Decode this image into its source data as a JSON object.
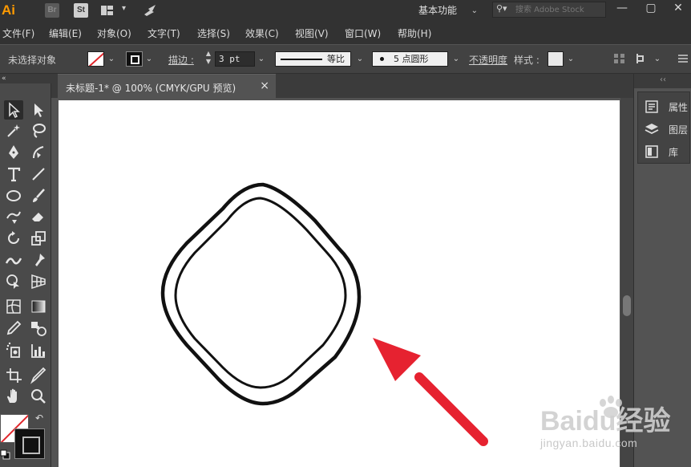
{
  "titlebar": {
    "app_logo": "Ai",
    "br_label": "Br",
    "st_label": "St",
    "workspace": "基本功能",
    "search_placeholder": "搜索 Adobe Stock",
    "minimize": "—",
    "maximize": "▢",
    "close": "✕"
  },
  "menu": {
    "items": [
      "文件(F)",
      "编辑(E)",
      "对象(O)",
      "文字(T)",
      "选择(S)",
      "效果(C)",
      "视图(V)",
      "窗口(W)",
      "帮助(H)"
    ]
  },
  "controlbar": {
    "selection_status": "未选择对象",
    "stroke_label": "描边 :",
    "stroke_weight": "3 pt",
    "stroke_profile": "等比",
    "brush_label": "5 点圆形",
    "opacity_label": "不透明度",
    "style_label": "样式 :"
  },
  "document": {
    "tab_title": "未标题-1* @ 100% (CMYK/GPU 预览)",
    "close_glyph": "×"
  },
  "right_dock": {
    "items": [
      {
        "label": "属性",
        "icon": "properties-icon"
      },
      {
        "label": "图层",
        "icon": "layers-icon"
      },
      {
        "label": "库",
        "icon": "libraries-icon"
      }
    ]
  },
  "watermark": {
    "brand": "Baidu经验",
    "url": "jingyan.baidu.com"
  },
  "colors": {
    "chrome_dark": "#323232",
    "panel": "#535353",
    "ai_orange": "#ff9a00",
    "arrow_red": "#e62230"
  }
}
